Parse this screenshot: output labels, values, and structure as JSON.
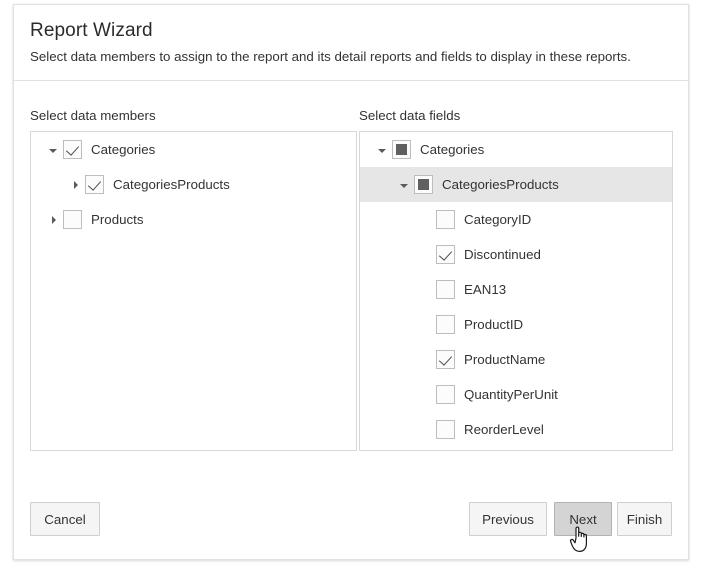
{
  "header": {
    "title": "Report Wizard",
    "subtitle": "Select data members to assign to the report and its detail reports and fields to display in these reports."
  },
  "panels": {
    "left": {
      "label": "Select data members",
      "nodes": [
        {
          "label": "Categories",
          "indent": 0,
          "expander": "open",
          "check": "checked",
          "selected": false
        },
        {
          "label": "CategoriesProducts",
          "indent": 1,
          "expander": "collapsed",
          "check": "checked",
          "selected": false
        },
        {
          "label": "Products",
          "indent": 0,
          "expander": "collapsed",
          "check": "unchecked",
          "selected": false
        }
      ]
    },
    "right": {
      "label": "Select data fields",
      "nodes": [
        {
          "label": "Categories",
          "indent": 0,
          "expander": "open",
          "check": "indeterminate",
          "selected": false
        },
        {
          "label": "CategoriesProducts",
          "indent": 1,
          "expander": "open",
          "check": "indeterminate",
          "selected": true
        },
        {
          "label": "CategoryID",
          "indent": 2,
          "expander": "none",
          "check": "unchecked",
          "selected": false
        },
        {
          "label": "Discontinued",
          "indent": 2,
          "expander": "none",
          "check": "checked",
          "selected": false
        },
        {
          "label": "EAN13",
          "indent": 2,
          "expander": "none",
          "check": "unchecked",
          "selected": false
        },
        {
          "label": "ProductID",
          "indent": 2,
          "expander": "none",
          "check": "unchecked",
          "selected": false
        },
        {
          "label": "ProductName",
          "indent": 2,
          "expander": "none",
          "check": "checked",
          "selected": false
        },
        {
          "label": "QuantityPerUnit",
          "indent": 2,
          "expander": "none",
          "check": "unchecked",
          "selected": false
        },
        {
          "label": "ReorderLevel",
          "indent": 2,
          "expander": "none",
          "check": "unchecked",
          "selected": false
        }
      ]
    }
  },
  "footer": {
    "cancel": "Cancel",
    "previous": "Previous",
    "next": "Next",
    "finish": "Finish",
    "hovered_button": "next"
  },
  "cursor": {
    "icon": "pointing-hand-cursor"
  },
  "colors": {
    "window_border": "#e2e2e2",
    "panel_border": "#d8d8d8",
    "selected_row": "#e6e6e6",
    "button_face": "#f5f5f5",
    "button_hover": "#d4d4d4",
    "text": "#333333",
    "checkbox_mark": "#4a4a4a",
    "indeterminate_fill": "#606060"
  }
}
